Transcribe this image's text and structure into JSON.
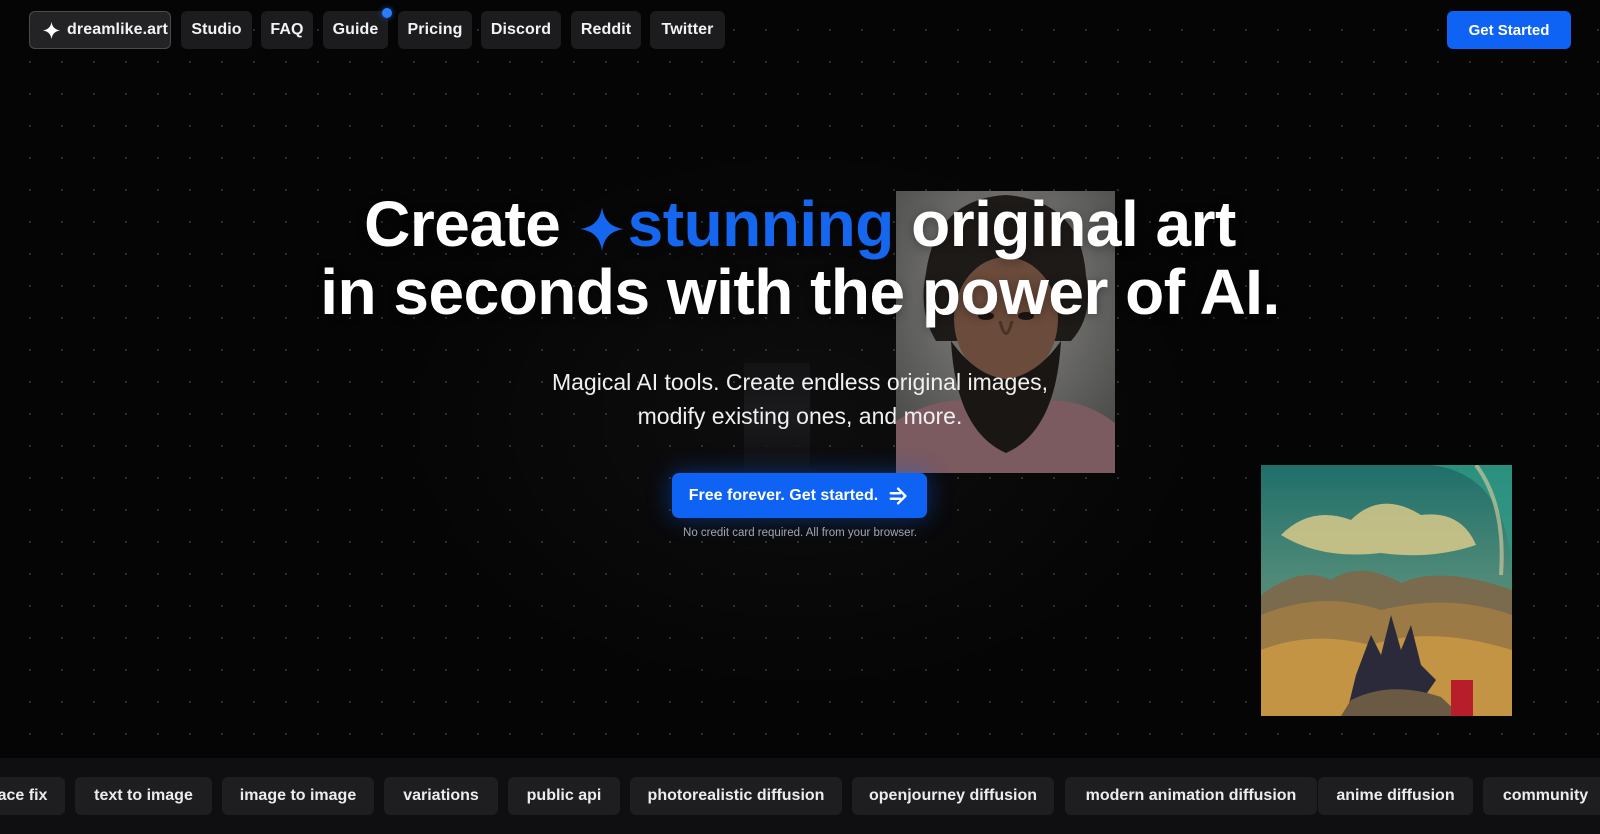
{
  "nav": {
    "logo_label": "dreamlike.art",
    "items": [
      {
        "label": "Studio"
      },
      {
        "label": "FAQ"
      },
      {
        "label": "Guide"
      },
      {
        "label": "Pricing"
      },
      {
        "label": "Discord"
      },
      {
        "label": "Reddit"
      },
      {
        "label": "Twitter"
      }
    ],
    "cta_label": "Get Started"
  },
  "hero": {
    "headline_pre": "Create ",
    "headline_accent": "stunning",
    "headline_post": " original art",
    "headline_line2": "in seconds with the power of AI.",
    "subhead_line1": "Magical AI tools. Create endless original images,",
    "subhead_line2": "modify existing ones, and more.",
    "cta_label": "Free forever. Get started.",
    "note": "No credit card required. All from your browser."
  },
  "tags": [
    {
      "label": "ace fix"
    },
    {
      "label": "text to image"
    },
    {
      "label": "image to image"
    },
    {
      "label": "variations"
    },
    {
      "label": "public api"
    },
    {
      "label": "photorealistic diffusion"
    },
    {
      "label": "openjourney diffusion"
    },
    {
      "label": "modern animation diffusion"
    },
    {
      "label": "anime diffusion"
    },
    {
      "label": "community"
    }
  ],
  "colors": {
    "background": "#050506",
    "accent_blue": "#0e63f4",
    "headline_accent": "#1467ee",
    "pill_bg": "#1c1c1f",
    "notification_dot": "#2a7dff"
  },
  "icons": {
    "logo": "sparkle-icon",
    "headline": "sparkle-icon",
    "cta": "arrow-right-icon"
  }
}
